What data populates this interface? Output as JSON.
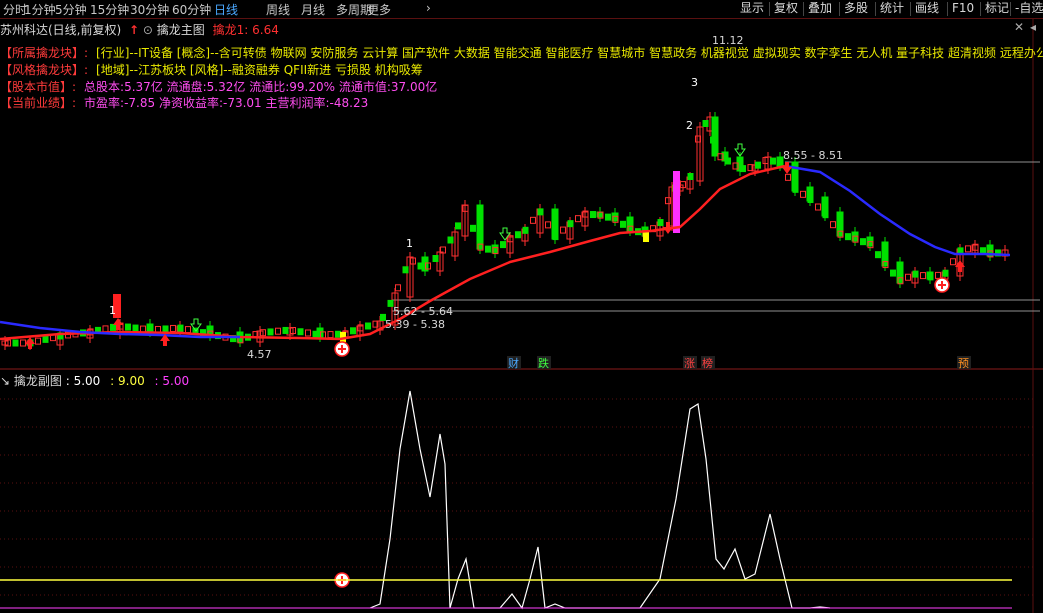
{
  "toolbar": {
    "left_tabs": [
      "分时",
      "1分钟",
      "5分钟",
      "15分钟",
      "30分钟",
      "60分钟",
      "日线",
      "周线",
      "月线",
      "多周期",
      "更多"
    ],
    "active_tab": "日线",
    "more_arrow": "›",
    "right_buttons": [
      "显示",
      "复权",
      "叠加",
      "多股",
      "统计",
      "画线",
      "F10",
      "标记",
      "-自选"
    ]
  },
  "main_pane": {
    "stock_title": "苏州科达(日线,前复权)",
    "indicator_name": "擒龙主图",
    "indicator_value": "擒龙1: 6.64",
    "info_lines": [
      {
        "label": "【所属擒龙块】:",
        "text": "[行业]--IT设备 [概念]--含可转债 物联网 安防服务 云计算 国产软件 大数据 智能交通 智能医疗 智慧城市 智慧政务 机器视觉 虚拟现实 数字孪生 无人机 量子科技 超清视频 远程办公 信"
      },
      {
        "label": "【风格擒龙块】:",
        "text": "[地域]--江苏板块 [风格]--融资融券 QFII新进 亏损股 机构吸筹"
      },
      {
        "label": "【股本市值】:",
        "text": "总股本:5.37亿 流通盘:5.32亿 流通比:99.20% 流通市值:37.00亿"
      },
      {
        "label": "【当前业绩】:",
        "text": "市盈率:-7.85 净资收益率:-73.01 主营利润率:-48.23"
      }
    ],
    "price_annotations": [
      "11.12",
      "8.55 - 8.51",
      "5.62 - 5.64",
      "5.39 - 5.38",
      "4.57"
    ],
    "number_markers": [
      "1",
      "1",
      "2",
      "3"
    ],
    "event_tags": [
      "财",
      "跌",
      "涨",
      "榜",
      "预"
    ]
  },
  "sub_pane": {
    "title": "擒龙副图",
    "v1": ": 5.00",
    "v2": ": 9.00",
    "v3": ": 5.00"
  },
  "colors": {
    "up": "#ff3030",
    "down": "#00e000",
    "ma_red": "#ff2020",
    "ma_blue": "#2020ff",
    "sub_white": "#ffffff",
    "sub_yellow": "#ffff40",
    "accent_magenta": "#ff40ff",
    "tab_active": "#4aa8ff"
  },
  "icons": [
    "down-arrow-icon",
    "toolbar-icon",
    "up-arrow-icon",
    "add-circle-icon",
    "close-icon",
    "scroll-arrow-icon"
  ]
}
